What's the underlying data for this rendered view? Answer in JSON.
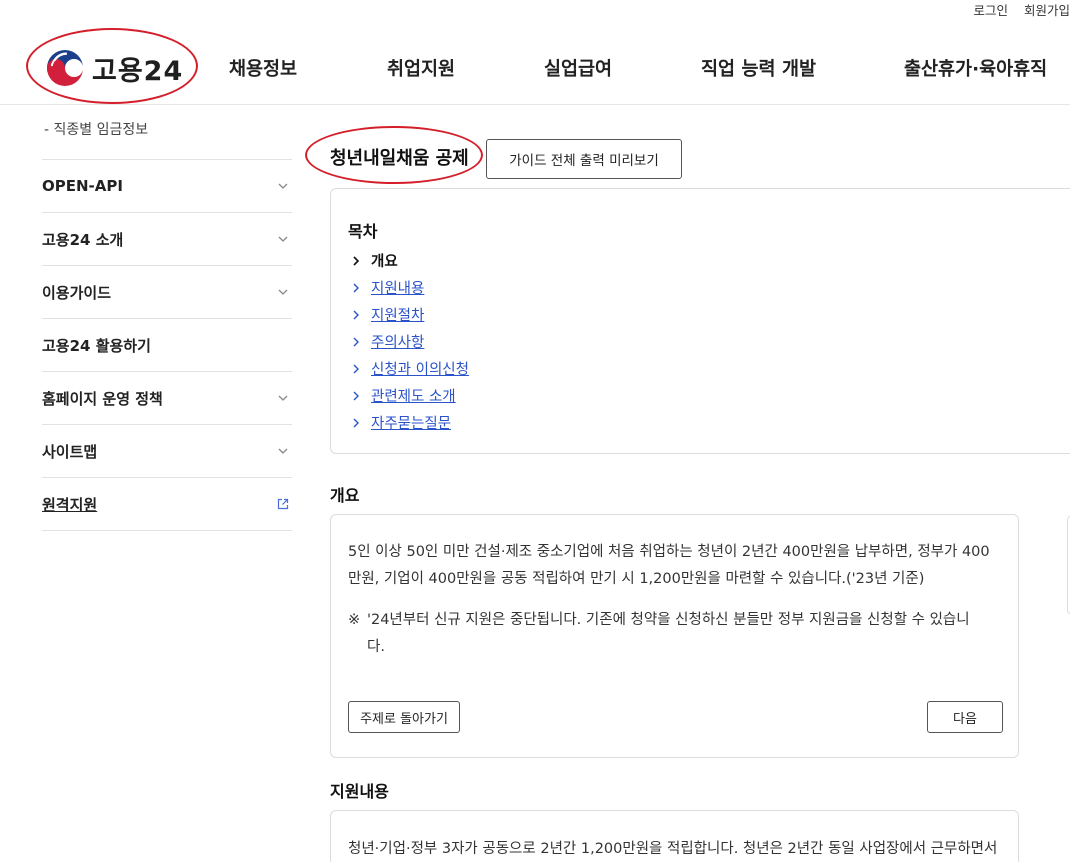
{
  "util_links": {
    "login": "로그인",
    "signup": "회원가입"
  },
  "header": {
    "logo_text": "고용24",
    "nav": [
      "채용정보",
      "취업지원",
      "실업급여",
      "직업 능력 개발",
      "출산휴가·육아휴직"
    ]
  },
  "sidebar": {
    "sub_link": "- 직종별 임금정보",
    "items": [
      {
        "label": "OPEN-API",
        "icon": "chevron-down-icon"
      },
      {
        "label": "고용24 소개",
        "icon": "chevron-down-icon"
      },
      {
        "label": "이용가이드",
        "icon": "chevron-down-icon"
      },
      {
        "label": "고용24 활용하기",
        "icon": ""
      },
      {
        "label": "홈페이지 운영 정책",
        "icon": "chevron-down-icon"
      },
      {
        "label": "사이트맵",
        "icon": "chevron-down-icon"
      },
      {
        "label": "원격지원",
        "icon": "external-link-icon"
      }
    ]
  },
  "content": {
    "page_title": "청년내일채움 공제",
    "preview_button": "가이드 전체 출력 미리보기",
    "toc": {
      "title": "목차",
      "items": [
        "개요",
        "지원내용",
        "지원절차",
        "주의사항",
        "신청과 이의신청",
        "관련제도 소개",
        "자주묻는질문"
      ]
    },
    "overview": {
      "title": "개요",
      "line1": "5인 이상 50인 미만 건설·제조 중소기업에 처음 취업하는 청년이 2년간 400만원을 납부하면, 정부가 400",
      "line2": "만원, 기업이 400만원을 공동 적립하여 만기 시 1,200만원을 마련할 수 있습니다.('23년 기준)",
      "note_mark": "※",
      "note_line1": "'24년부터 신규 지원은 중단됩니다. 기존에 청약을 신청하신 분들만 정부 지원금을 신청할 수 있습니",
      "note_line2": "다.",
      "back_button": "주제로 돌아가기",
      "next_button": "다음"
    },
    "support": {
      "title": "지원내용",
      "line1": "청년·기업·정부 3자가 공동으로 2년간 1,200만원을 적립합니다. 청년은 2년간 동일 사업장에서 근무하면서"
    }
  },
  "colors": {
    "accent_ring": "#d41e2a",
    "link": "#2b53c9",
    "border": "#dcdcdc"
  }
}
